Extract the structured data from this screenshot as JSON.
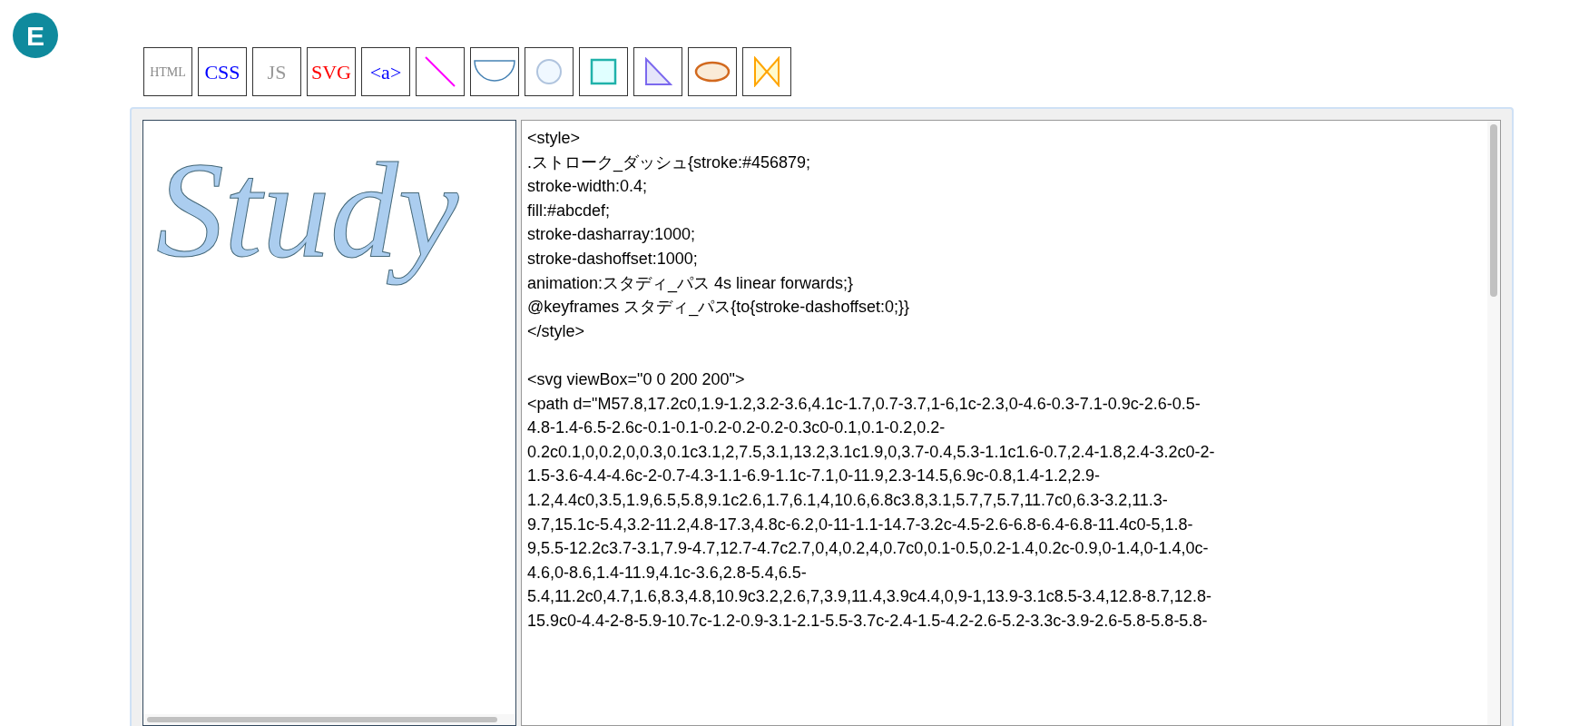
{
  "logo": {
    "letter": "E"
  },
  "toolbar": [
    {
      "kind": "text",
      "label": "HTML",
      "color": "#888888"
    },
    {
      "kind": "text",
      "label": "CSS",
      "color": "#0000ff"
    },
    {
      "kind": "text",
      "label": "JS",
      "color": "#999999"
    },
    {
      "kind": "text",
      "label": "SVG",
      "color": "#ff0000"
    },
    {
      "kind": "text",
      "label": "<a>",
      "color": "#0000ff"
    },
    {
      "kind": "line"
    },
    {
      "kind": "half-circle"
    },
    {
      "kind": "circle"
    },
    {
      "kind": "square"
    },
    {
      "kind": "triangle"
    },
    {
      "kind": "ellipse"
    },
    {
      "kind": "bowtie"
    }
  ],
  "preview": {
    "text": "Study"
  },
  "editor": {
    "blocks": [
      [
        "<style>",
        ".ストローク_ダッシュ{stroke:#456879;",
        "stroke-width:0.4;",
        "fill:#abcdef;",
        "stroke-dasharray:1000;",
        "stroke-dashoffset:1000;",
        "animation:スタディ_パス 4s linear forwards;}",
        "@keyframes スタディ_パス{to{stroke-dashoffset:0;}}",
        "</style>"
      ],
      [
        "<svg viewBox=\"0 0 200 200\">",
        "<path d=\"M57.8,17.2c0,1.9-1.2,3.2-3.6,4.1c-1.7,0.7-3.7,1-6,1c-2.3,0-4.6-0.3-7.1-0.9c-2.6-0.5-",
        "4.8-1.4-6.5-2.6c-0.1-0.1-0.2-0.2-0.2-0.3c0-0.1,0.1-0.2,0.2-",
        "0.2c0.1,0,0.2,0,0.3,0.1c3.1,2,7.5,3.1,13.2,3.1c1.9,0,3.7-0.4,5.3-1.1c1.6-0.7,2.4-1.8,2.4-3.2c0-2-",
        "1.5-3.6-4.4-4.6c-2-0.7-4.3-1.1-6.9-1.1c-7.1,0-11.9,2.3-14.5,6.9c-0.8,1.4-1.2,2.9-",
        "1.2,4.4c0,3.5,1.9,6.5,5.8,9.1c2.6,1.7,6.1,4,10.6,6.8c3.8,3.1,5.7,7,5.7,11.7c0,6.3-3.2,11.3-",
        "9.7,15.1c-5.4,3.2-11.2,4.8-17.3,4.8c-6.2,0-11-1.1-14.7-3.2c-4.5-2.6-6.8-6.4-6.8-11.4c0-5,1.8-",
        "9,5.5-12.2c3.7-3.1,7.9-4.7,12.7-4.7c2.7,0,4,0.2,4,0.7c0,0.1-0.5,0.2-1.4,0.2c-0.9,0-1.4,0-1.4,0c-",
        "4.6,0-8.6,1.4-11.9,4.1c-3.6,2.8-5.4,6.5-",
        "5.4,11.2c0,4.7,1.6,8.3,4.8,10.9c3.2,2.6,7,3.9,11.4,3.9c4.4,0,9-1,13.9-3.1c8.5-3.4,12.8-8.7,12.8-",
        "15.9c0-4.4-2-8-5.9-10.7c-1.2-0.9-3.1-2.1-5.5-3.7c-2.4-1.5-4.2-2.6-5.2-3.3c-3.9-2.6-5.8-5.8-5.8-"
      ]
    ]
  }
}
